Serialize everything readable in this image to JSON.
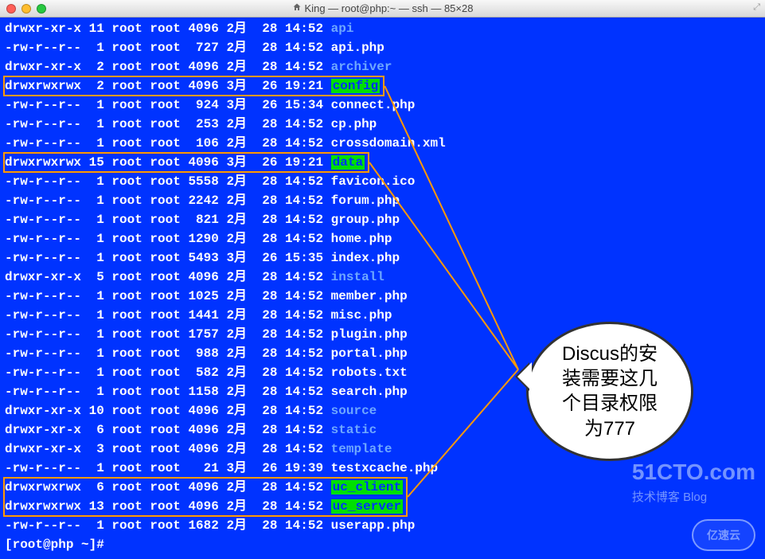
{
  "window": {
    "title": "King — root@php:~ — ssh — 85×28"
  },
  "bubble_text": "Discus的安\n装需要这几\n个目录权限\n为777",
  "watermark1_main": "51CTO.com",
  "watermark1_sub": "技术博客  Blog",
  "watermark2": "亿速云",
  "prompt": "[root@php ~]#",
  "rows": [
    {
      "perm": "drwxr-xr-x",
      "links": "11",
      "own": "root",
      "grp": "root",
      "size": "4096",
      "mon": "2月",
      "day": "28",
      "time": "14:52",
      "name": "api",
      "cls": "dir"
    },
    {
      "perm": "-rw-r--r--",
      "links": "1",
      "own": "root",
      "grp": "root",
      "size": "727",
      "mon": "2月",
      "day": "28",
      "time": "14:52",
      "name": "api.php",
      "cls": "file"
    },
    {
      "perm": "drwxr-xr-x",
      "links": "2",
      "own": "root",
      "grp": "root",
      "size": "4096",
      "mon": "2月",
      "day": "28",
      "time": "14:52",
      "name": "archiver",
      "cls": "dir"
    },
    {
      "perm": "drwxrwxrwx",
      "links": "2",
      "own": "root",
      "grp": "root",
      "size": "4096",
      "mon": "3月",
      "day": "26",
      "time": "19:21",
      "name": "config",
      "cls": "d777",
      "hl": true
    },
    {
      "perm": "-rw-r--r--",
      "links": "1",
      "own": "root",
      "grp": "root",
      "size": "924",
      "mon": "3月",
      "day": "26",
      "time": "15:34",
      "name": "connect.php",
      "cls": "file"
    },
    {
      "perm": "-rw-r--r--",
      "links": "1",
      "own": "root",
      "grp": "root",
      "size": "253",
      "mon": "2月",
      "day": "28",
      "time": "14:52",
      "name": "cp.php",
      "cls": "file"
    },
    {
      "perm": "-rw-r--r--",
      "links": "1",
      "own": "root",
      "grp": "root",
      "size": "106",
      "mon": "2月",
      "day": "28",
      "time": "14:52",
      "name": "crossdomain.xml",
      "cls": "file"
    },
    {
      "perm": "drwxrwxrwx",
      "links": "15",
      "own": "root",
      "grp": "root",
      "size": "4096",
      "mon": "3月",
      "day": "26",
      "time": "19:21",
      "name": "data",
      "cls": "d777",
      "hl": true
    },
    {
      "perm": "-rw-r--r--",
      "links": "1",
      "own": "root",
      "grp": "root",
      "size": "5558",
      "mon": "2月",
      "day": "28",
      "time": "14:52",
      "name": "favicon.ico",
      "cls": "file"
    },
    {
      "perm": "-rw-r--r--",
      "links": "1",
      "own": "root",
      "grp": "root",
      "size": "2242",
      "mon": "2月",
      "day": "28",
      "time": "14:52",
      "name": "forum.php",
      "cls": "file"
    },
    {
      "perm": "-rw-r--r--",
      "links": "1",
      "own": "root",
      "grp": "root",
      "size": "821",
      "mon": "2月",
      "day": "28",
      "time": "14:52",
      "name": "group.php",
      "cls": "file"
    },
    {
      "perm": "-rw-r--r--",
      "links": "1",
      "own": "root",
      "grp": "root",
      "size": "1290",
      "mon": "2月",
      "day": "28",
      "time": "14:52",
      "name": "home.php",
      "cls": "file"
    },
    {
      "perm": "-rw-r--r--",
      "links": "1",
      "own": "root",
      "grp": "root",
      "size": "5493",
      "mon": "3月",
      "day": "26",
      "time": "15:35",
      "name": "index.php",
      "cls": "file"
    },
    {
      "perm": "drwxr-xr-x",
      "links": "5",
      "own": "root",
      "grp": "root",
      "size": "4096",
      "mon": "2月",
      "day": "28",
      "time": "14:52",
      "name": "install",
      "cls": "dir"
    },
    {
      "perm": "-rw-r--r--",
      "links": "1",
      "own": "root",
      "grp": "root",
      "size": "1025",
      "mon": "2月",
      "day": "28",
      "time": "14:52",
      "name": "member.php",
      "cls": "file"
    },
    {
      "perm": "-rw-r--r--",
      "links": "1",
      "own": "root",
      "grp": "root",
      "size": "1441",
      "mon": "2月",
      "day": "28",
      "time": "14:52",
      "name": "misc.php",
      "cls": "file"
    },
    {
      "perm": "-rw-r--r--",
      "links": "1",
      "own": "root",
      "grp": "root",
      "size": "1757",
      "mon": "2月",
      "day": "28",
      "time": "14:52",
      "name": "plugin.php",
      "cls": "file"
    },
    {
      "perm": "-rw-r--r--",
      "links": "1",
      "own": "root",
      "grp": "root",
      "size": "988",
      "mon": "2月",
      "day": "28",
      "time": "14:52",
      "name": "portal.php",
      "cls": "file"
    },
    {
      "perm": "-rw-r--r--",
      "links": "1",
      "own": "root",
      "grp": "root",
      "size": "582",
      "mon": "2月",
      "day": "28",
      "time": "14:52",
      "name": "robots.txt",
      "cls": "file"
    },
    {
      "perm": "-rw-r--r--",
      "links": "1",
      "own": "root",
      "grp": "root",
      "size": "1158",
      "mon": "2月",
      "day": "28",
      "time": "14:52",
      "name": "search.php",
      "cls": "file"
    },
    {
      "perm": "drwxr-xr-x",
      "links": "10",
      "own": "root",
      "grp": "root",
      "size": "4096",
      "mon": "2月",
      "day": "28",
      "time": "14:52",
      "name": "source",
      "cls": "dir"
    },
    {
      "perm": "drwxr-xr-x",
      "links": "6",
      "own": "root",
      "grp": "root",
      "size": "4096",
      "mon": "2月",
      "day": "28",
      "time": "14:52",
      "name": "static",
      "cls": "dir"
    },
    {
      "perm": "drwxr-xr-x",
      "links": "3",
      "own": "root",
      "grp": "root",
      "size": "4096",
      "mon": "2月",
      "day": "28",
      "time": "14:52",
      "name": "template",
      "cls": "dir"
    },
    {
      "perm": "-rw-r--r--",
      "links": "1",
      "own": "root",
      "grp": "root",
      "size": "21",
      "mon": "3月",
      "day": "26",
      "time": "19:39",
      "name": "testxcache.php",
      "cls": "file"
    },
    {
      "perm": "drwxrwxrwx",
      "links": "6",
      "own": "root",
      "grp": "root",
      "size": "4096",
      "mon": "2月",
      "day": "28",
      "time": "14:52",
      "name": "uc_client",
      "cls": "d777",
      "hl": true
    },
    {
      "perm": "drwxrwxrwx",
      "links": "13",
      "own": "root",
      "grp": "root",
      "size": "4096",
      "mon": "2月",
      "day": "28",
      "time": "14:52",
      "name": "uc_server",
      "cls": "d777",
      "hl": true
    },
    {
      "perm": "-rw-r--r--",
      "links": "1",
      "own": "root",
      "grp": "root",
      "size": "1682",
      "mon": "2月",
      "day": "28",
      "time": "14:52",
      "name": "userapp.php",
      "cls": "file"
    }
  ]
}
